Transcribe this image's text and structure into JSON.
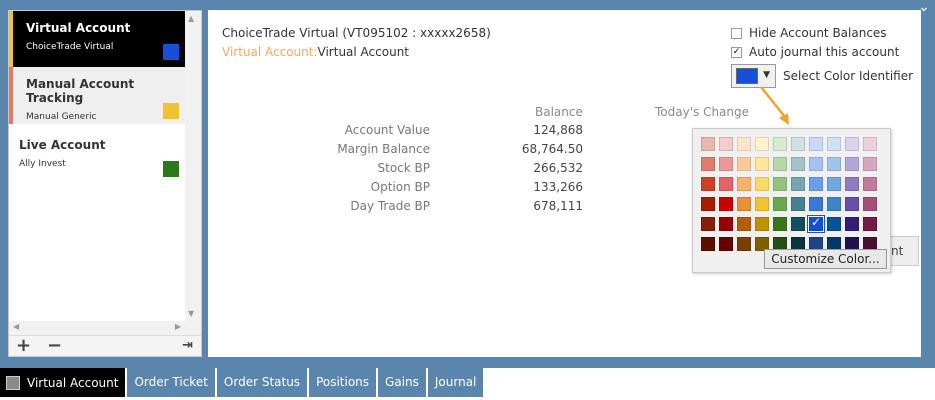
{
  "accounts": [
    {
      "name": "Virtual Account",
      "sub": "ChoiceTrade Virtual",
      "color": "#1650d8"
    },
    {
      "name": "Manual Account Tracking",
      "sub": "Manual Generic",
      "color": "#f2c12e"
    },
    {
      "name": "Live Account",
      "sub": "Ally Invest",
      "color": "#2a7a1c"
    }
  ],
  "toolbar": {
    "add": "+",
    "remove": "−",
    "exit": "⇥"
  },
  "main": {
    "title": "ChoiceTrade Virtual (VT095102 : xxxxx2658)",
    "type_label": "Virtual Account:",
    "type_value": "Virtual Account",
    "hide_balances": "Hide Account Balances",
    "auto_journal": "Auto journal this account",
    "select_color": "Select Color Identifier",
    "balance_head": "Balance",
    "change_head": "Today's Change",
    "rows": [
      {
        "label": "Account Value",
        "value": "124,868"
      },
      {
        "label": "Margin Balance",
        "value": "68,764.50"
      },
      {
        "label": "Stock BP",
        "value": "266,532"
      },
      {
        "label": "Option BP",
        "value": "133,266"
      },
      {
        "label": "Day Trade BP",
        "value": "678,111"
      }
    ],
    "hidden_btn_text": "nt"
  },
  "palette": {
    "customize": "Customize Color...",
    "colors": [
      "#e6b8b0",
      "#f4cccc",
      "#fce5cd",
      "#fff2cc",
      "#d9ead3",
      "#d0e0e3",
      "#c9daf8",
      "#cfe2f3",
      "#d9d2e9",
      "#ead1dc",
      "#dd7e6b",
      "#ea9999",
      "#f9cb9c",
      "#ffe599",
      "#b6d7a8",
      "#a2c4c9",
      "#a4c2f4",
      "#9fc5e8",
      "#b4a7d6",
      "#d5a6bd",
      "#cc4125",
      "#e06666",
      "#f6b26b",
      "#ffd966",
      "#93c47d",
      "#76a5af",
      "#6d9eeb",
      "#6fa8dc",
      "#8e7cc3",
      "#c27ba0",
      "#a61c00",
      "#cc0000",
      "#e69138",
      "#f1c232",
      "#6aa84f",
      "#45818e",
      "#3c78d8",
      "#3d85c6",
      "#674ea7",
      "#a64d79",
      "#85200c",
      "#990000",
      "#b45f06",
      "#bf9000",
      "#38761d",
      "#134f5c",
      "#1650d8",
      "#0b5394",
      "#351c75",
      "#741b47",
      "#5b0f00",
      "#660000",
      "#783f04",
      "#7f6000",
      "#274e13",
      "#0c343d",
      "#1c4587",
      "#073763",
      "#20124d",
      "#4c1130"
    ],
    "selected_index": 46
  },
  "tabs": [
    "Virtual Account",
    "Order Ticket",
    "Order Status",
    "Positions",
    "Gains",
    "Journal"
  ],
  "accent": "#f2a22e"
}
